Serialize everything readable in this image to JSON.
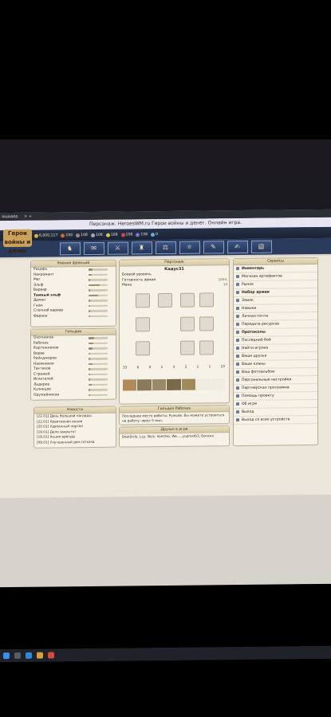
{
  "browser": {
    "tab_title": "ащадер",
    "window_title": "Персонаж. HeroesWM.ru Герои войны и денег. Онлайн игра."
  },
  "topbar": {
    "logo_text": "Герои войны и денег",
    "resources": [
      {
        "value": "6,000,117",
        "color": "#d9b24a"
      },
      {
        "value": "100",
        "color": "#c96d2a"
      },
      {
        "value": "108",
        "color": "#a08a6a"
      },
      {
        "value": "108",
        "color": "#9fa8b0"
      },
      {
        "value": "108",
        "color": "#d6c64a"
      },
      {
        "value": "108",
        "color": "#c94a4a"
      },
      {
        "value": "108",
        "color": "#8a6ad6"
      },
      {
        "value": "0",
        "color": "#5ab0e8"
      }
    ]
  },
  "left_factions": {
    "title": "Умения фракций",
    "items": [
      {
        "label": "Рыцарь",
        "bold": false,
        "fill": 0.2
      },
      {
        "label": "Некромант",
        "bold": false,
        "fill": 0.15
      },
      {
        "label": "Маг",
        "bold": false,
        "fill": 0.1
      },
      {
        "label": "Эльф",
        "bold": false,
        "fill": 0.6
      },
      {
        "label": "Варвар",
        "bold": false,
        "fill": 0.1
      },
      {
        "label": "Темный эльф",
        "bold": true,
        "fill": 0.5
      },
      {
        "label": "Демон",
        "bold": false,
        "fill": 0.1
      },
      {
        "label": "Гном",
        "bold": false,
        "fill": 0.1
      },
      {
        "label": "Степной варвар",
        "bold": false,
        "fill": 0.1
      },
      {
        "label": "Фараон",
        "bold": false,
        "fill": 0.1
      }
    ]
  },
  "guilds": {
    "title": "Гильдии",
    "items": [
      {
        "label": "Охотников",
        "fill": 0.3
      },
      {
        "label": "Рабочих",
        "fill": 0.25
      },
      {
        "label": "Картежников",
        "fill": 0.2
      },
      {
        "label": "Воров",
        "fill": 0.1
      },
      {
        "label": "Рейнджеров",
        "fill": 0.1
      },
      {
        "label": "Наемников",
        "fill": 0.2
      },
      {
        "label": "Тактиков",
        "fill": 0.1
      },
      {
        "label": "Стражей",
        "fill": 0.1
      },
      {
        "label": "Искателей",
        "fill": 0.1
      },
      {
        "label": "Лидеров",
        "fill": 0.15
      },
      {
        "label": "Кузнецов",
        "fill": 0.1
      },
      {
        "label": "Оружейников",
        "fill": 0.1
      }
    ]
  },
  "news": {
    "title": "Новости",
    "items": [
      "[22.01] День большой награды",
      "[22.01] Креативная акция",
      "[20.01] Удвоенный портал",
      "[19.01] Дело закрыто!",
      "[18.01] Акция аренды",
      "[09.01] Улучшенный дом (отказа"
    ]
  },
  "character": {
    "title": "Персонаж",
    "name": "Кадус31",
    "stats": [
      {
        "label": "Боевой уровень",
        "value": ""
      },
      {
        "label": "Готовность армии",
        "value": "100%"
      },
      {
        "label": "Мана",
        "value": "10"
      }
    ],
    "army_counts": [
      "33",
      "6",
      "0",
      "1",
      "3",
      "2",
      "1",
      "1",
      "10"
    ]
  },
  "workers_guild": {
    "title": "Гильдия Рабочих",
    "text": "Последнее место работы: Ружьев. Вы можете устроиться на работу через 5 мин."
  },
  "friends": {
    "title": "Друзья в игре",
    "text": "BoatSicle, Lcy, Nick, VolcOro, We..., yuprost63, Богиня"
  },
  "services": {
    "title": "Сервисы",
    "items": [
      {
        "label": "Инвентарь",
        "bold": true
      },
      {
        "label": "Магазин артефактов",
        "bold": false
      },
      {
        "label": "Рынок",
        "bold": false
      },
      {
        "label": "Набор армии",
        "bold": true
      },
      {
        "label": "Замок",
        "bold": false
      },
      {
        "label": "Навыки",
        "bold": false
      },
      {
        "label": "Личная почта",
        "bold": false
      },
      {
        "label": "Передача ресурсов",
        "bold": false
      },
      {
        "label": "Протоколы",
        "bold": true
      },
      {
        "label": "Последний бой",
        "bold": false
      },
      {
        "label": "Найти игрока",
        "bold": false
      },
      {
        "label": "Ваши друзья",
        "bold": false
      },
      {
        "label": "Ваши кланы",
        "bold": false
      },
      {
        "label": "Ваш фотоальбом",
        "bold": false
      },
      {
        "label": "Персональные настройки",
        "bold": false
      },
      {
        "label": "Партнерская программа",
        "bold": false
      },
      {
        "label": "Помощь проекту",
        "bold": false
      },
      {
        "label": "Об игре",
        "bold": false
      },
      {
        "label": "Выход",
        "bold": false
      },
      {
        "label": "Выход со всех устройств",
        "bold": false
      }
    ]
  }
}
